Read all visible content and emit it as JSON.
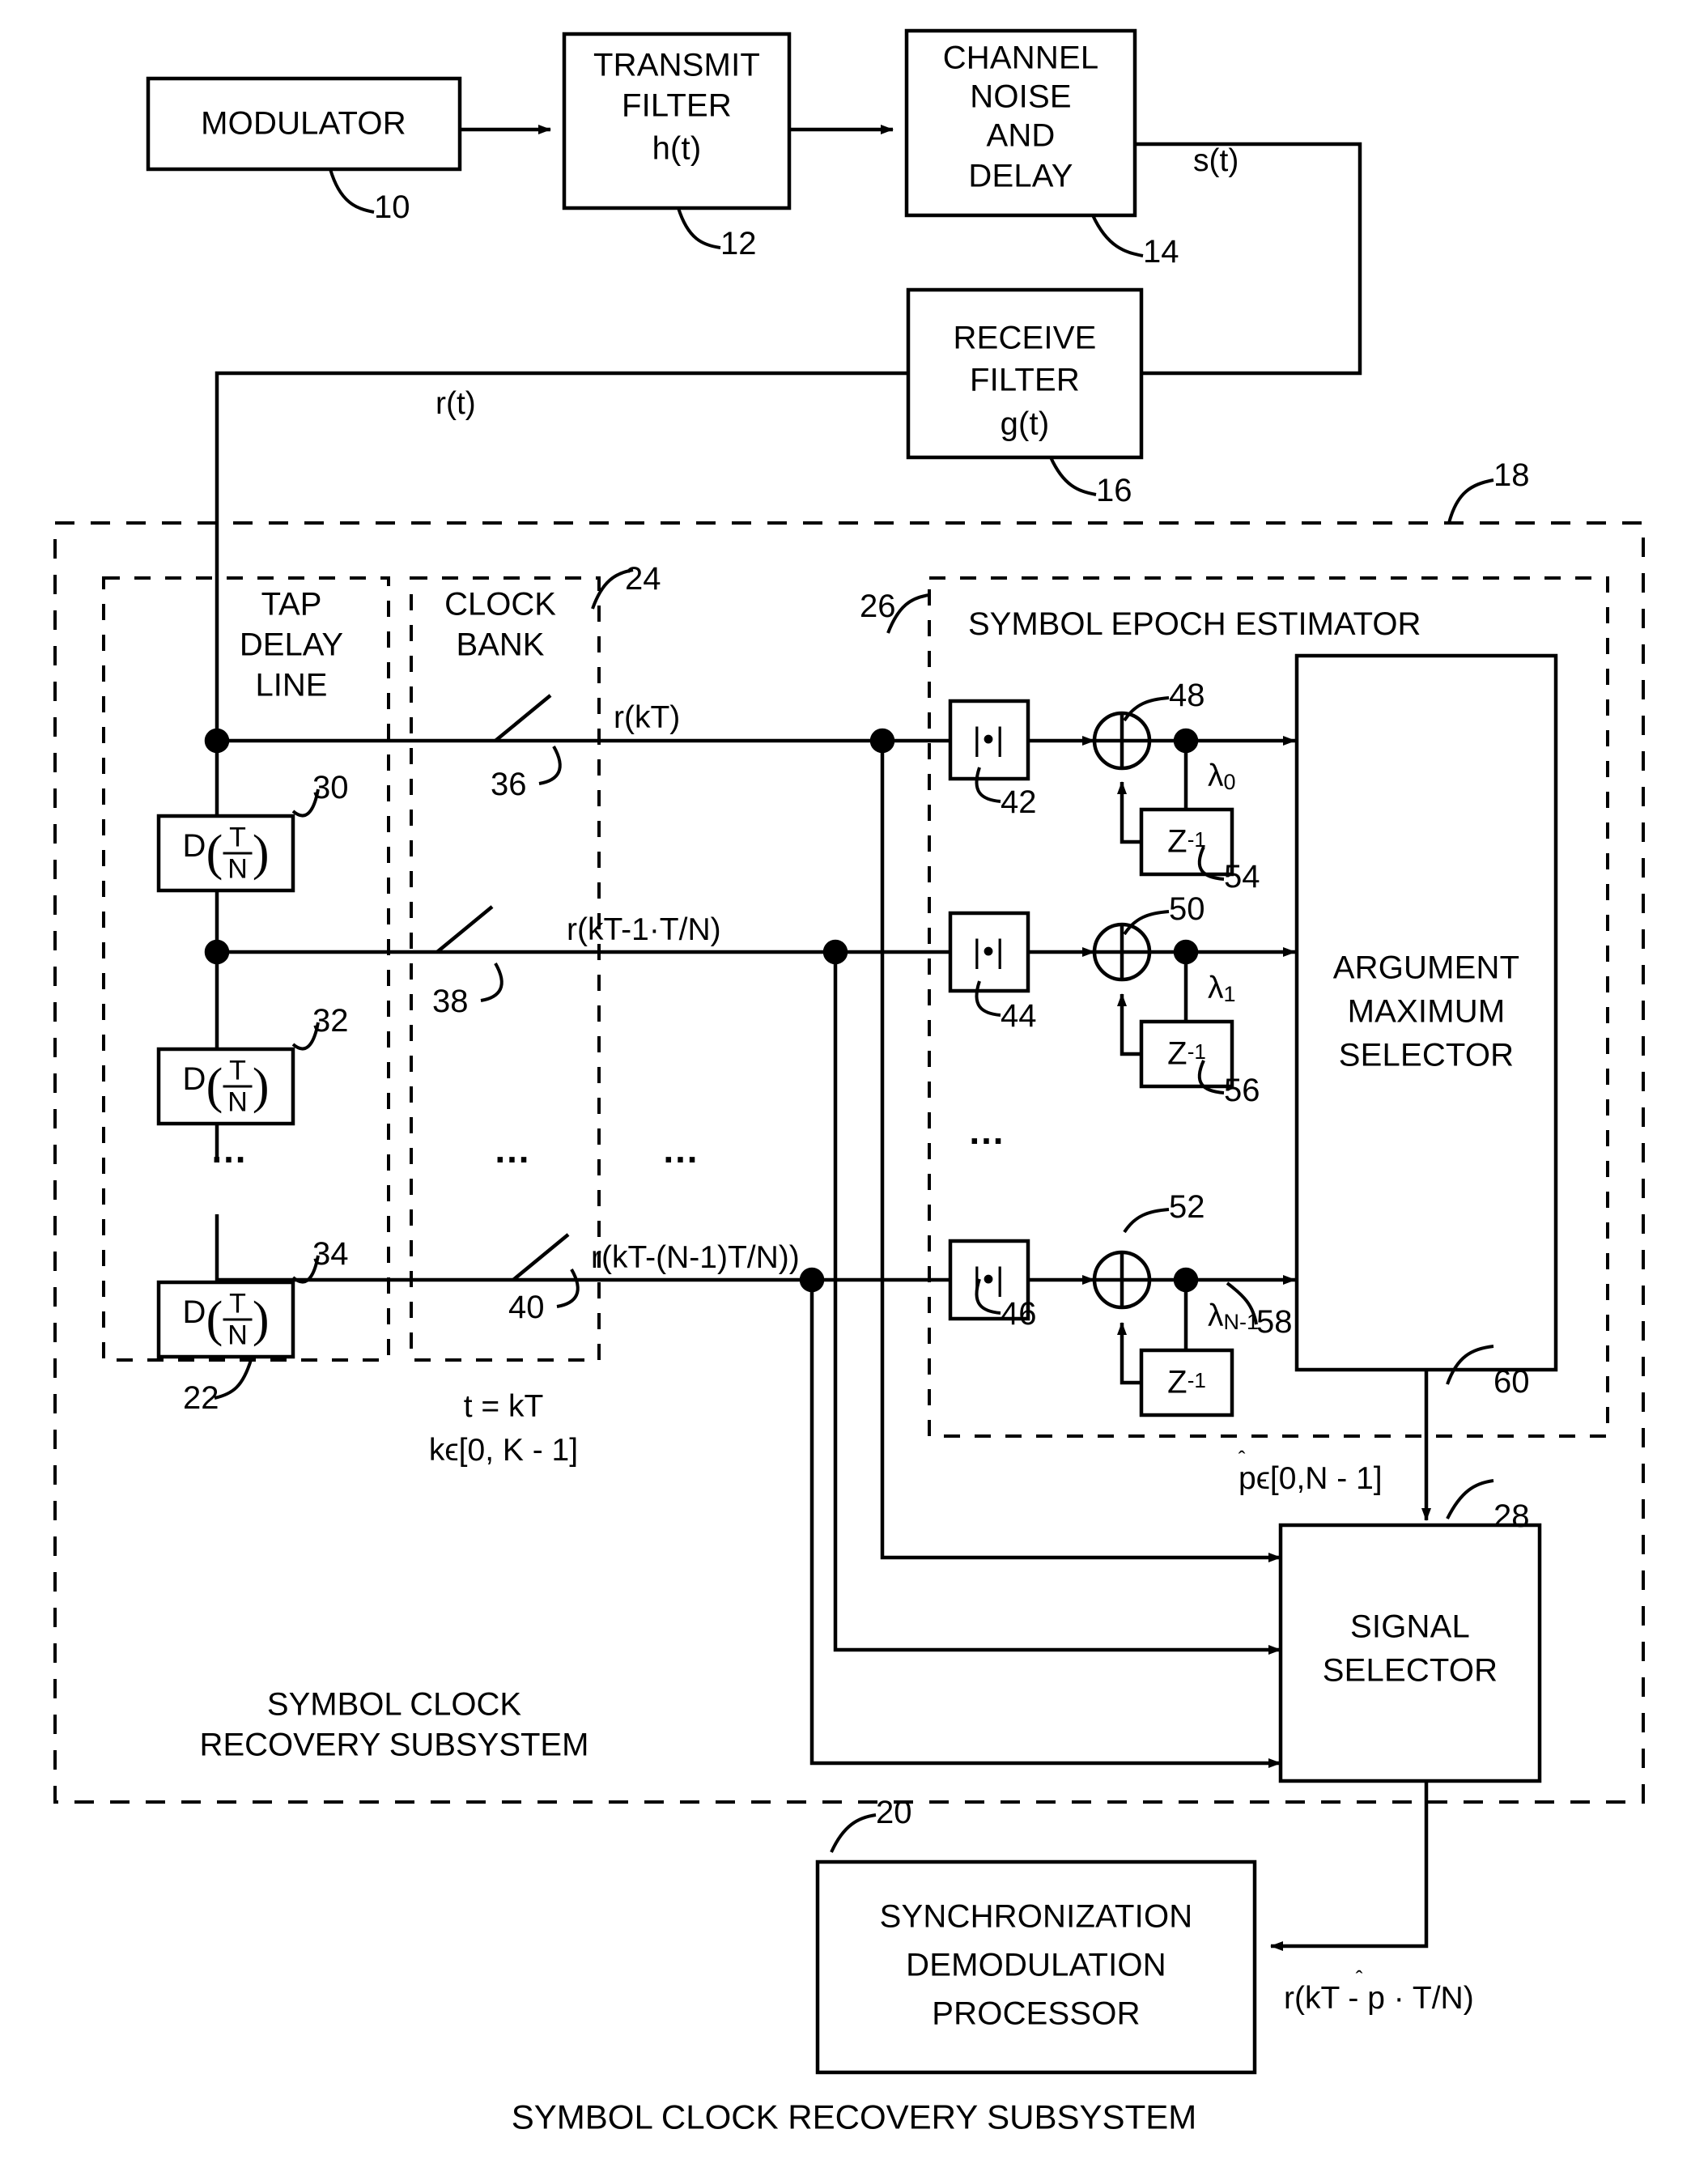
{
  "figure": {
    "caption": "SYMBOL CLOCK RECOVERY SUBSYSTEM"
  },
  "blocks": {
    "modulator": {
      "label": "MODULATOR",
      "ref": "10"
    },
    "transmit_filter": {
      "line1": "TRANSMIT",
      "line2": "FILTER",
      "line3": "h(t)",
      "ref": "12"
    },
    "channel": {
      "line1": "CHANNEL",
      "line2": "NOISE",
      "line3": "AND",
      "line4": "DELAY",
      "ref": "14"
    },
    "receive_filter": {
      "line1": "RECEIVE",
      "line2": "FILTER",
      "line3": "g(t)",
      "ref": "16"
    },
    "arg_max": {
      "line1": "ARGUMENT",
      "line2": "MAXIMUM",
      "line3": "SELECTOR",
      "ref": "60"
    },
    "signal_selector": {
      "line1": "SIGNAL",
      "line2": "SELECTOR",
      "ref": "28"
    },
    "sync_demod": {
      "line1": "SYNCHRONIZATION",
      "line2": "DEMODULATION",
      "line3": "PROCESSOR",
      "ref": "20"
    }
  },
  "sections": {
    "subsystem_outer": {
      "ref": "18",
      "label_line1": "SYMBOL CLOCK",
      "label_line2": "RECOVERY SUBSYSTEM"
    },
    "tap_delay_line": {
      "line1": "TAP",
      "line2": "DELAY",
      "line3": "LINE",
      "ref": "22"
    },
    "clock_bank": {
      "line1": "CLOCK",
      "line2": "BANK",
      "ref": "24",
      "timing_line1": "t = kT",
      "timing_line2": "kϵ[0, K - 1]"
    },
    "epoch_estimator": {
      "label": "SYMBOL EPOCH ESTIMATOR",
      "ref": "26"
    }
  },
  "delays": [
    {
      "prefix": "D",
      "num": "T",
      "den": "N",
      "ref": "30"
    },
    {
      "prefix": "D",
      "num": "T",
      "den": "N",
      "ref": "32"
    },
    {
      "prefix": "D",
      "num": "T",
      "den": "N",
      "ref": "34"
    }
  ],
  "switches": [
    {
      "ref": "36"
    },
    {
      "ref": "38"
    },
    {
      "ref": "40"
    }
  ],
  "abs_blocks": [
    {
      "glyph": "|•|",
      "ref": "42"
    },
    {
      "glyph": "|•|",
      "ref": "44"
    },
    {
      "glyph": "|•|",
      "ref": "46"
    }
  ],
  "adders": [
    {
      "ref": "48"
    },
    {
      "ref": "50"
    },
    {
      "ref": "52"
    }
  ],
  "unit_delays": [
    {
      "label": "Z",
      "exp": "-1",
      "ref": "54"
    },
    {
      "label": "Z",
      "exp": "-1",
      "ref": "56"
    },
    {
      "label": "Z",
      "exp": "-1",
      "ref": "58"
    }
  ],
  "signals": {
    "s_t": "s(t)",
    "r_t": "r(t)",
    "tap0": "r(kT)",
    "tap1": "r(kT-1·T/N)",
    "tap2": "r(kT-(N-1)T/N))",
    "lambda0": "λ",
    "lambda0_sub": "0",
    "lambda1": "λ",
    "lambda1_sub": "1",
    "lambdaN": "λ",
    "lambdaN_sub": "N-1",
    "p_hat": "pϵ[0,N - 1]",
    "output": "r(kT - p · T/N)",
    "ellipsis": "…"
  }
}
